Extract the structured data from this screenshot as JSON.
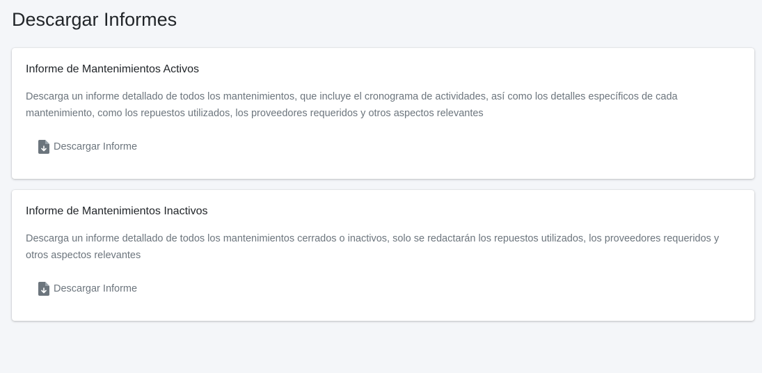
{
  "page": {
    "title": "Descargar Informes"
  },
  "reports": [
    {
      "title": "Informe de Mantenimientos Activos",
      "description": "Descarga un informe detallado de todos los mantenimientos, que incluye el cronograma de actividades, así como los detalles específicos de cada mantenimiento, como los repuestos utilizados, los proveedores requeridos y otros aspectos relevantes",
      "button_label": "Descargar Informe",
      "button_icon": "file-download-icon"
    },
    {
      "title": "Informe de Mantenimientos Inactivos",
      "description": "Descarga un informe detallado de todos los mantenimientos cerrados o inactivos, solo se redactarán los repuestos utilizados, los proveedores requeridos y otros aspectos relevantes",
      "button_label": "Descargar Informe",
      "button_icon": "file-download-icon"
    }
  ],
  "colors": {
    "background": "#f4f6f9",
    "card": "#ffffff",
    "muted_text": "#6c757d",
    "heading_text": "#212529"
  }
}
